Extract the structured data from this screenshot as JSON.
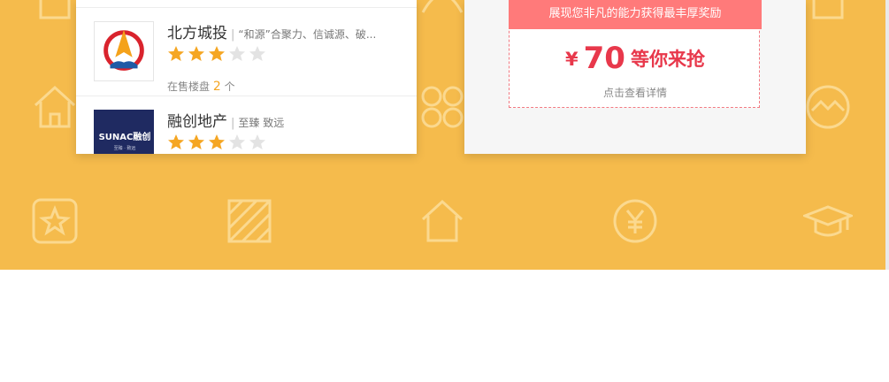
{
  "developers": [
    {
      "name": "北方城投",
      "slogan": "“和源”合聚力、信诚源、破...",
      "rating": 3,
      "max_rating": 5,
      "count_prefix": "在售楼盘",
      "count": "2",
      "count_suffix": "个",
      "logo_icon": "beifang-chengtou-logo-icon"
    },
    {
      "name": "融创地产",
      "slogan": "至臻 致远",
      "rating": 3,
      "max_rating": 5,
      "logo_icon": "sunac-logo-icon",
      "logo_text": "SUNAC融创",
      "logo_sub": "至臻 · 致远"
    }
  ],
  "promo": {
    "banner": "展现您非凡的能力获得最丰厚奖励",
    "currency": "¥",
    "amount": "70",
    "amount_text": "等你来抢",
    "detail_link": "点击查看详情"
  },
  "colors": {
    "band": "#f5bb4c",
    "star_on": "#f5a623",
    "star_off": "#e3e3e3",
    "coupon_banner": "#ff7a7a",
    "amount": "#e8384b"
  }
}
